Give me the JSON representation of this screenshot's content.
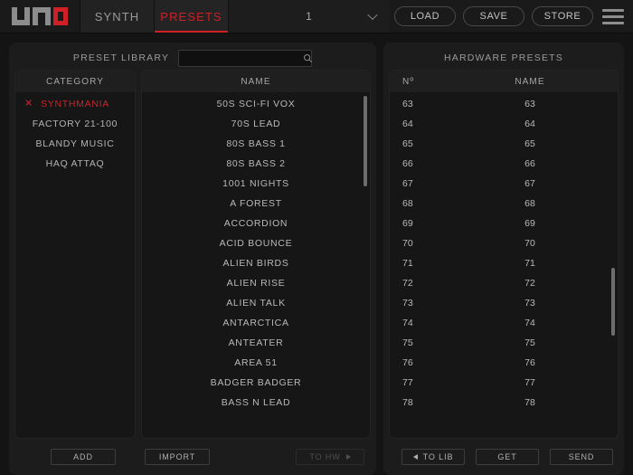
{
  "topbar": {
    "logo_name": "uno-logo",
    "tabs": [
      {
        "label": "SYNTH",
        "active": false
      },
      {
        "label": "PRESETS",
        "active": true
      }
    ],
    "patch_selector": {
      "value": "1",
      "icon": "chevron-down-icon"
    },
    "buttons": [
      {
        "label": "LOAD"
      },
      {
        "label": "SAVE"
      },
      {
        "label": "STORE"
      }
    ],
    "menu_icon": "hamburger-menu-icon"
  },
  "library": {
    "title": "PRESET LIBRARY",
    "search": {
      "value": "",
      "placeholder": "",
      "icon": "search-icon"
    },
    "category": {
      "header": "CATEGORY",
      "items": [
        {
          "label": "SYNTHMANIA",
          "selected": true,
          "remove_icon": "close-icon"
        },
        {
          "label": "FACTORY 21-100",
          "selected": false
        },
        {
          "label": "BLANDY MUSIC",
          "selected": false
        },
        {
          "label": "HAQ ATTAQ",
          "selected": false
        }
      ]
    },
    "names": {
      "header": "NAME",
      "items": [
        "50S SCI-FI VOX",
        "70S LEAD",
        "80S BASS 1",
        "80S BASS 2",
        "1001 NIGHTS",
        "A FOREST",
        "ACCORDION",
        "ACID BOUNCE",
        "ALIEN BIRDS",
        "ALIEN RISE",
        "ALIEN TALK",
        "ANTARCTICA",
        "ANTEATER",
        "AREA 51",
        "BADGER BADGER",
        "BASS N LEAD"
      ]
    },
    "footer": {
      "add_label": "ADD",
      "import_label": "IMPORT",
      "to_hw_label": "TO HW"
    }
  },
  "hardware": {
    "title": "HARDWARE PRESETS",
    "columns": {
      "number": "Nº",
      "name": "NAME"
    },
    "rows": [
      {
        "number": "63",
        "name": "63"
      },
      {
        "number": "64",
        "name": "64"
      },
      {
        "number": "65",
        "name": "65"
      },
      {
        "number": "66",
        "name": "66"
      },
      {
        "number": "67",
        "name": "67"
      },
      {
        "number": "68",
        "name": "68"
      },
      {
        "number": "69",
        "name": "69"
      },
      {
        "number": "70",
        "name": "70"
      },
      {
        "number": "71",
        "name": "71"
      },
      {
        "number": "72",
        "name": "72"
      },
      {
        "number": "73",
        "name": "73"
      },
      {
        "number": "74",
        "name": "74"
      },
      {
        "number": "75",
        "name": "75"
      },
      {
        "number": "76",
        "name": "76"
      },
      {
        "number": "77",
        "name": "77"
      },
      {
        "number": "78",
        "name": "78"
      }
    ],
    "footer": {
      "to_lib_label": "TO LIB",
      "get_label": "GET",
      "send_label": "SEND"
    }
  },
  "colors": {
    "accent_red": "#cf2027",
    "background": "#141414",
    "panel": "#1c1c1c",
    "text": "#b9b9b9"
  }
}
